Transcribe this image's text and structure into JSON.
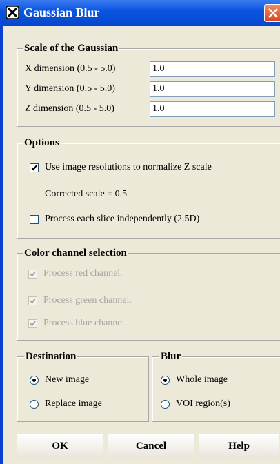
{
  "window": {
    "title": "Gaussian Blur",
    "icon": "app-icon",
    "close_icon": "close-icon"
  },
  "scale": {
    "legend": "Scale of the Gaussian",
    "fields": [
      {
        "label": "X dimension (0.5 - 5.0)",
        "value": "1.0"
      },
      {
        "label": "Y dimension (0.5 - 5.0)",
        "value": "1.0"
      },
      {
        "label": "Z dimension (0.5 - 5.0)",
        "value": "1.0"
      }
    ]
  },
  "options": {
    "legend": "Options",
    "normalize_label": "Use image resolutions to normalize Z scale",
    "normalize_checked": true,
    "corrected_scale": "Corrected scale = 0.5",
    "slice_label": "Process each slice independently (2.5D)",
    "slice_checked": false
  },
  "color": {
    "legend": "Color channel selection",
    "red": "Process red channel.",
    "green": "Process green channel.",
    "blue": "Process blue channel.",
    "enabled": false,
    "checked": true
  },
  "destination": {
    "legend": "Destination",
    "new_image": "New image",
    "replace_image": "Replace image",
    "selected": "New image"
  },
  "blur": {
    "legend": "Blur",
    "whole_image": "Whole image",
    "voi": "VOI region(s)",
    "selected": "Whole image"
  },
  "buttons": {
    "ok": "OK",
    "cancel": "Cancel",
    "help": "Help"
  },
  "colors": {
    "titlebar": "#0a55e0",
    "panel": "#ece9d8",
    "close": "#d8461c"
  }
}
